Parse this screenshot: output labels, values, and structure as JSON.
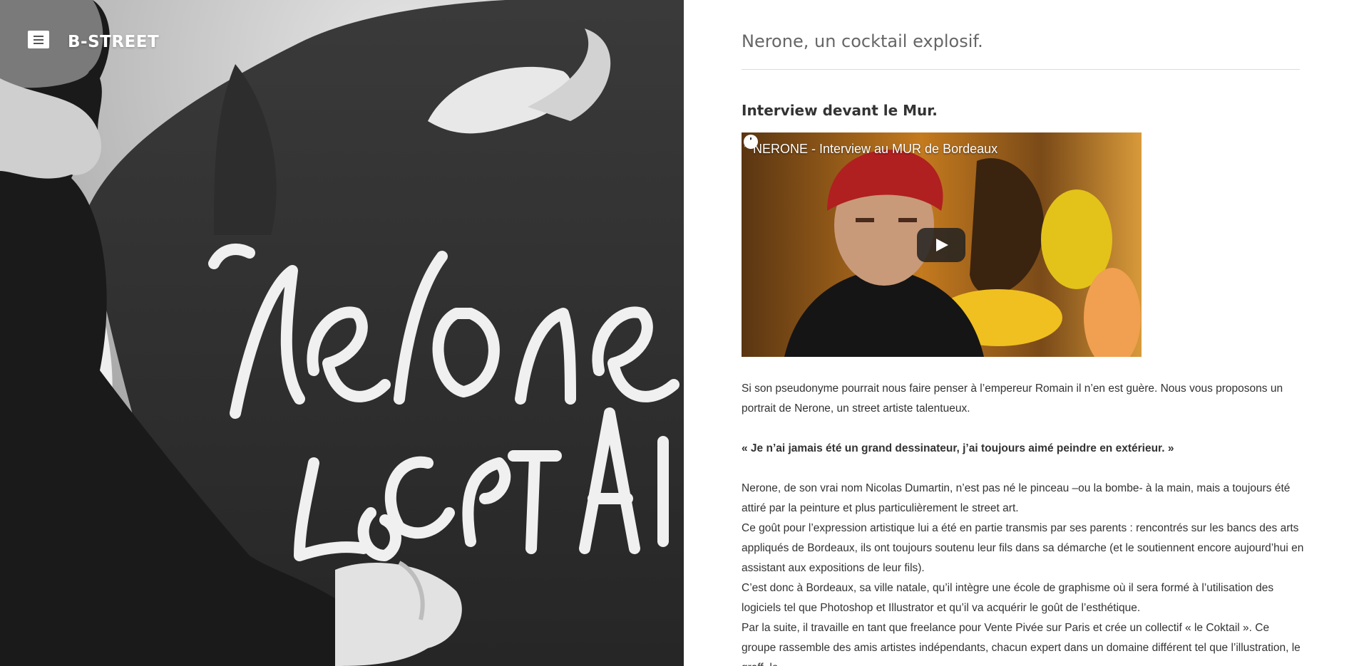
{
  "site": {
    "brand": "B-STREET",
    "menu_icon": "hamburger-menu-icon"
  },
  "article": {
    "title": "Nerone, un cocktail explosif.",
    "subtitle": "Interview devant le Mur.",
    "video": {
      "title": "NERONE - Interview au MUR de Bordeaux",
      "icons": [
        "clock-icon",
        "share-icon",
        "play-icon"
      ]
    },
    "intro": "Si son pseudonyme pourrait nous faire penser à l’empereur Romain il n’en est guère. Nous vous proposons un portrait de Nerone, un street artiste talentueux.",
    "quote": "« Je n’ai jamais été un grand dessinateur, j’ai toujours aimé peindre en extérieur. »",
    "paragraphs": [
      "Nerone, de son vrai nom Nicolas Dumartin, n’est pas né le pinceau –ou la bombe- à la main, mais a toujours été attiré par la peinture et plus particulièrement le street art.",
      "Ce goût pour l’expression artistique lui a été en partie transmis par ses parents : rencontrés sur les bancs des arts appliqués de Bordeaux, ils ont toujours soutenu leur fils dans sa démarche (et le soutiennent encore aujourd’hui en assistant aux expositions de leur fils).",
      "C’est donc à Bordeaux, sa ville natale, qu’il intègre une école de graphisme où il sera formé à l’utilisation des logiciels tel que Photoshop et Illustrator et qu’il va acquérir le goût de l’esthétique.",
      "Par la suite, il travaille en tant que freelance pour Vente Pivée sur Paris et crée un collectif « le Coktail ». Ce groupe rassemble des amis artistes indépendants, chacun expert dans un domaine différent tel que l’illustration, le graff, le"
    ]
  },
  "colors": {
    "title": "#666666",
    "body_text": "#333333",
    "brand_text": "#ffffff"
  }
}
